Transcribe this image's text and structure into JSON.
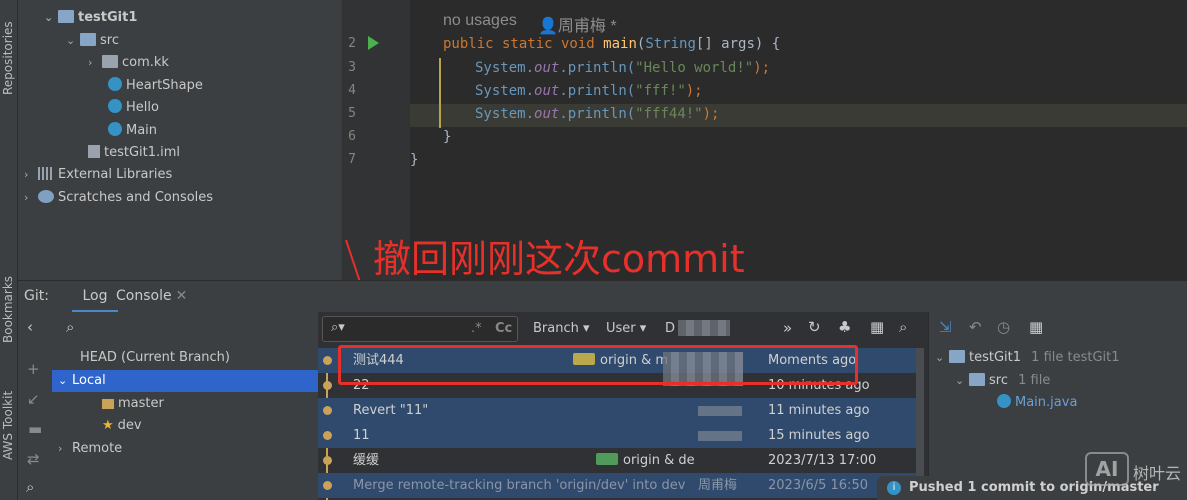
{
  "left_strip": {
    "labels": [
      "Repositories",
      "Bookmarks",
      "AWS Toolkit"
    ]
  },
  "project_tree": {
    "items": [
      {
        "label": "testGit1",
        "type": "module"
      },
      {
        "label": "src",
        "type": "folder"
      },
      {
        "label": "com.kk",
        "type": "package"
      },
      {
        "label": "HeartShape",
        "type": "class"
      },
      {
        "label": "Hello",
        "type": "class"
      },
      {
        "label": "Main",
        "type": "class"
      },
      {
        "label": "testGit1.iml",
        "type": "file"
      },
      {
        "label": "External Libraries",
        "type": "libs"
      },
      {
        "label": "Scratches and Consoles",
        "type": "scratch"
      }
    ]
  },
  "editor": {
    "line_numbers": [
      "2",
      "3",
      "4",
      "5",
      "6",
      "7"
    ],
    "usage_hint": "no usages",
    "author_hint": "周甫梅 *",
    "method_line": [
      "public static void ",
      "main",
      "(",
      "String",
      "[] args) {"
    ],
    "lines": [
      {
        "obj": "System.",
        "field": "out",
        "call": ".println(",
        "str": "\"Hello world!\"",
        "end": ");"
      },
      {
        "obj": "System.",
        "field": "out",
        "call": ".println(",
        "str": "\"fff!\"",
        "end": ");"
      },
      {
        "obj": "System.",
        "field": "out",
        "call": ".println(",
        "str": "\"fff44!\"",
        "end": ");"
      }
    ],
    "close_method": "}",
    "close_class": "}"
  },
  "annotation": "撤回刚刚这次commit",
  "git": {
    "label": "Git:",
    "tabs": [
      "Log",
      "Console"
    ],
    "branches": {
      "head": "HEAD (Current Branch)",
      "local": "Local",
      "local_items": [
        "master",
        "dev"
      ],
      "remote": "Remote"
    },
    "filters": {
      "branch": "Branch ▾",
      "user": "User ▾",
      "date": "D"
    },
    "commits": [
      {
        "message": "测试444",
        "tag": "origin & m",
        "time": "Moments ago",
        "selected": true
      },
      {
        "message": "22",
        "tag": "",
        "time": "10 minutes ago",
        "selected": false
      },
      {
        "message": "Revert \"11\"",
        "tag": "",
        "time": "11 minutes ago",
        "selected": true
      },
      {
        "message": "11",
        "tag": "",
        "time": "15 minutes ago",
        "selected": true
      },
      {
        "message": "缓缓",
        "tag": "origin & de",
        "time": "2023/7/13 17:00",
        "selected": false
      },
      {
        "message": "Merge remote-tracking branch 'origin/dev' into dev",
        "author": "周甫梅",
        "tag": "",
        "time": "2023/6/5 16:50",
        "selected": true
      }
    ],
    "details": {
      "root": "testGit1",
      "root_meta": "1 file  testGit1",
      "folder": "src",
      "folder_meta": "1 file",
      "file": "Main.java"
    }
  },
  "notification": "Pushed 1 commit to origin/master",
  "watermark": "树叶云"
}
